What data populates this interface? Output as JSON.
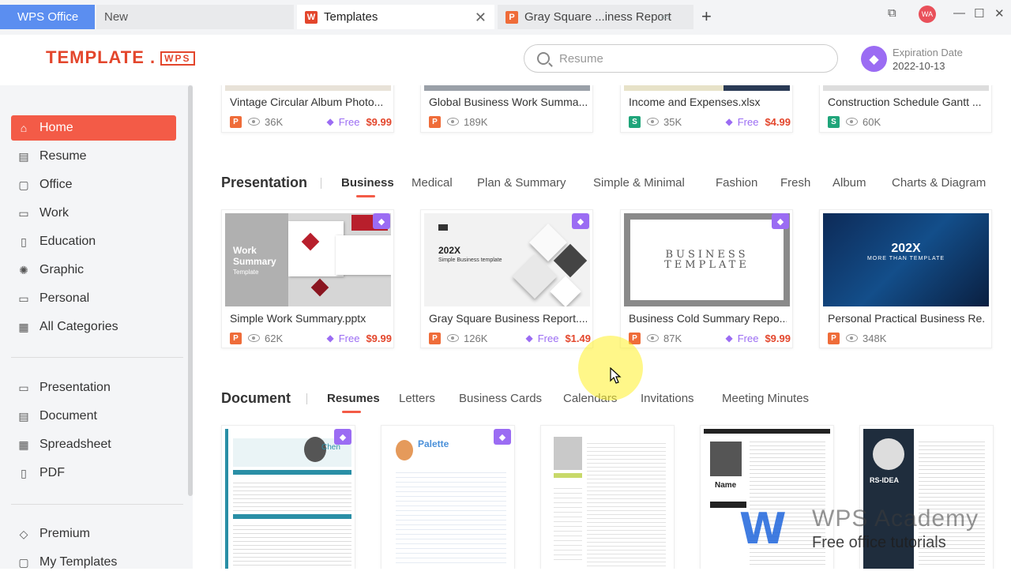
{
  "tabs": [
    {
      "label": "WPS Office"
    },
    {
      "label": "New"
    },
    {
      "label": "Templates"
    },
    {
      "label": "Gray Square ...iness Report"
    }
  ],
  "window": {
    "avatar": "WA"
  },
  "header": {
    "logo_text": "TEMPLATE .",
    "logo_badge": "WPS",
    "search_placeholder": "Resume",
    "expiration_label": "Expiration Date",
    "expiration_date": "2022-10-13"
  },
  "sidebar": {
    "items": [
      {
        "label": "Home",
        "icon": "home-icon"
      },
      {
        "label": "Resume",
        "icon": "resume-icon"
      },
      {
        "label": "Office",
        "icon": "office-icon"
      },
      {
        "label": "Work",
        "icon": "work-icon"
      },
      {
        "label": "Education",
        "icon": "education-icon"
      },
      {
        "label": "Graphic",
        "icon": "graphic-icon"
      },
      {
        "label": "Personal",
        "icon": "personal-icon"
      },
      {
        "label": "All Categories",
        "icon": "grid-icon"
      },
      {
        "label": "Presentation",
        "icon": "presentation-icon"
      },
      {
        "label": "Document",
        "icon": "document-icon"
      },
      {
        "label": "Spreadsheet",
        "icon": "spreadsheet-icon"
      },
      {
        "label": "PDF",
        "icon": "pdf-icon"
      },
      {
        "label": "Premium",
        "icon": "premium-icon"
      },
      {
        "label": "My Templates",
        "icon": "my-templates-icon"
      }
    ]
  },
  "top_cards": [
    {
      "title": "Vintage Circular Album Photo...",
      "type": "P",
      "views": "36K",
      "free": "Free",
      "price": "$9.99"
    },
    {
      "title": "Global Business Work Summa...",
      "type": "P",
      "views": "189K",
      "free": "",
      "price": ""
    },
    {
      "title": "Income and Expenses.xlsx",
      "type": "S",
      "views": "35K",
      "free": "Free",
      "price": "$4.99"
    },
    {
      "title": "Construction Schedule Gantt ...",
      "type": "S",
      "views": "60K",
      "free": "",
      "price": ""
    }
  ],
  "presentation": {
    "title": "Presentation",
    "categories": [
      "Business",
      "Medical",
      "Plan & Summary",
      "Simple & Minimal",
      "Fashion",
      "Fresh",
      "Album",
      "Charts & Diagram"
    ],
    "cards": [
      {
        "title": "Simple Work Summary.pptx",
        "views": "62K",
        "free": "Free",
        "price": "$9.99",
        "thumb_line1": "Work",
        "thumb_line2": "Summary",
        "thumb_line3": "Template"
      },
      {
        "title": "Gray Square Business Report....",
        "views": "126K",
        "free": "Free",
        "price": "$1.49",
        "thumb_line1": "202X",
        "thumb_line2": "Simple Business template"
      },
      {
        "title": "Business Cold Summary Repo...",
        "views": "87K",
        "free": "Free",
        "price": "$9.99",
        "thumb_line1": "BUSINESS",
        "thumb_line2": "TEMPLATE"
      },
      {
        "title": "Personal Practical Business Re...",
        "views": "348K",
        "free": "",
        "price": "",
        "thumb_line1": "202X",
        "thumb_line2": "MORE THAN TEMPLATE"
      }
    ]
  },
  "document": {
    "title": "Document",
    "categories": [
      "Resumes",
      "Letters",
      "Business Cards",
      "Calendars",
      "Invitations",
      "Meeting Minutes"
    ],
    "cards": [
      {
        "thumb_text": "Chen"
      },
      {
        "thumb_text": "Palette"
      },
      {
        "thumb_text": ""
      },
      {
        "thumb_text": "Name"
      },
      {
        "thumb_text": "RS-IDEA"
      }
    ]
  },
  "watermark": {
    "brand": "WPS Academy",
    "tagline": "Free office tutorials"
  },
  "colors": {
    "accent": "#f35b47",
    "premium": "#9b6cf3",
    "price": "#e3462c",
    "tab_blue": "#5b8ef0"
  }
}
